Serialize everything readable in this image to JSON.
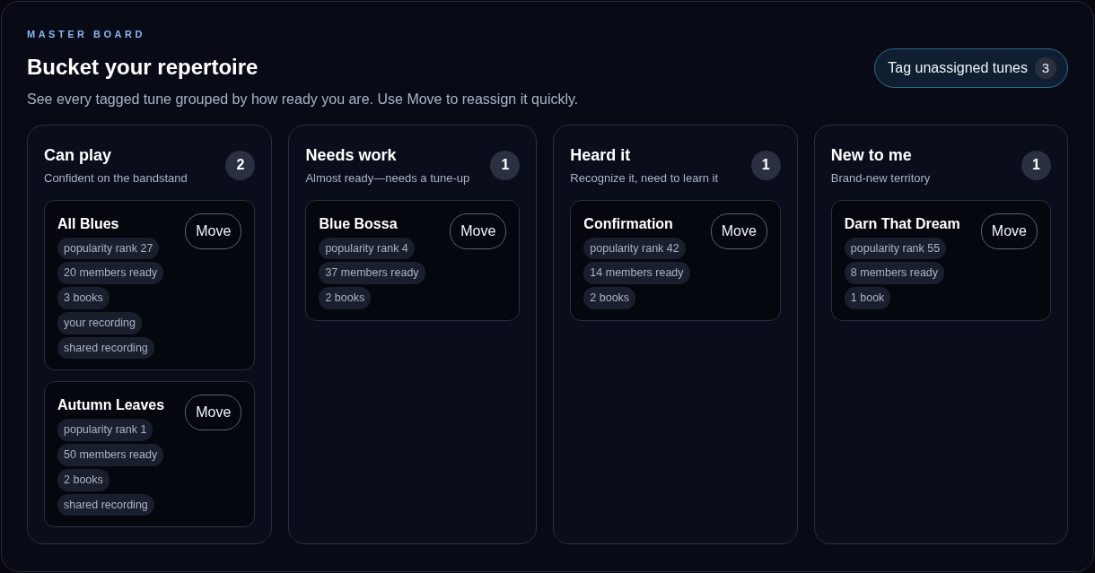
{
  "eyebrow": "MASTER BOARD",
  "title": "Bucket your repertoire",
  "subtitle": "See every tagged tune grouped by how ready you are. Use Move to reassign it quickly.",
  "tag_button": {
    "label": "Tag unassigned tunes",
    "count": "3"
  },
  "columns": [
    {
      "title": "Can play",
      "description": "Confident on the bandstand",
      "count": "2",
      "tunes": [
        {
          "title": "All Blues",
          "button": "Move",
          "tags": [
            "popularity rank 27",
            "20 members ready",
            "3 books",
            "your recording",
            "shared recording"
          ]
        },
        {
          "title": "Autumn Leaves",
          "button": "Move",
          "tags": [
            "popularity rank 1",
            "50 members ready",
            "2 books",
            "shared recording"
          ]
        }
      ]
    },
    {
      "title": "Needs work",
      "description": "Almost ready—needs a tune-up",
      "count": "1",
      "tunes": [
        {
          "title": "Blue Bossa",
          "button": "Move",
          "tags": [
            "popularity rank 4",
            "37 members ready",
            "2 books"
          ]
        }
      ]
    },
    {
      "title": "Heard it",
      "description": "Recognize it, need to learn it",
      "count": "1",
      "tunes": [
        {
          "title": "Confirmation",
          "button": "Move",
          "tags": [
            "popularity rank 42",
            "14 members ready",
            "2 books"
          ]
        }
      ]
    },
    {
      "title": "New to me",
      "description": "Brand-new territory",
      "count": "1",
      "tunes": [
        {
          "title": "Darn That Dream",
          "button": "Move",
          "tags": [
            "popularity rank 55",
            "8 members ready",
            "1 book"
          ]
        }
      ]
    }
  ]
}
